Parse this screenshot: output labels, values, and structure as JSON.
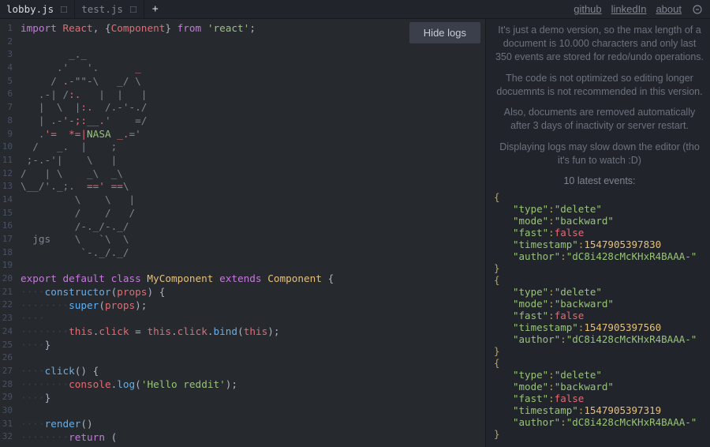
{
  "header": {
    "tabs": [
      {
        "label": "lobby.js",
        "active": true
      },
      {
        "label": "test.js",
        "active": false
      }
    ],
    "links": {
      "github": "github",
      "linkedin": "linkedIn",
      "about": "about"
    }
  },
  "hide_logs_button": "Hide logs",
  "code": {
    "lines": [
      [
        {
          "c": "tok-kw",
          "t": "import "
        },
        {
          "c": "tok-id",
          "t": "React"
        },
        {
          "c": "tok-op",
          "t": ", {"
        },
        {
          "c": "tok-id",
          "t": "Component"
        },
        {
          "c": "tok-op",
          "t": "} "
        },
        {
          "c": "tok-kw",
          "t": "from "
        },
        {
          "c": "tok-str",
          "t": "'react'"
        },
        {
          "c": "tok-op",
          "t": ";"
        }
      ],
      [],
      [
        {
          "c": "tok-cm-d",
          "t": "        _._"
        }
      ],
      [
        {
          "c": "tok-cm-d",
          "t": "      .'   '."
        },
        {
          "c": "tok-cm-r",
          "t": "      _"
        }
      ],
      [
        {
          "c": "tok-cm-d",
          "t": "     / "
        },
        {
          "c": "tok-cm-r",
          "t": "."
        },
        {
          "c": "tok-cm-d",
          "t": "-\"\"-\\   _/ \\"
        }
      ],
      [
        {
          "c": "tok-cm-d",
          "t": "   .-| /"
        },
        {
          "c": "tok-cm-r",
          "t": ":."
        },
        {
          "c": "tok-cm-d",
          "t": "   |  |   |"
        }
      ],
      [
        {
          "c": "tok-cm-d",
          "t": "   |  \\  |"
        },
        {
          "c": "tok-cm-r",
          "t": ":."
        },
        {
          "c": "tok-cm-d",
          "t": "  /.-'-./"
        }
      ],
      [
        {
          "c": "tok-cm-d",
          "t": "   | .-"
        },
        {
          "c": "tok-cm-r",
          "t": "'-;:__."
        },
        {
          "c": "tok-cm-d",
          "t": "'    =/"
        }
      ],
      [
        {
          "c": "tok-cm-d",
          "t": "   ."
        },
        {
          "c": "tok-cm-r",
          "t": "'=  *=|"
        },
        {
          "c": "tok-cm-g",
          "t": "NASA"
        },
        {
          "c": "tok-cm-r",
          "t": " _."
        },
        {
          "c": "tok-cm-d",
          "t": "='"
        }
      ],
      [
        {
          "c": "tok-cm-d",
          "t": "  /   _.  |    ;"
        }
      ],
      [
        {
          "c": "tok-cm-d",
          "t": " ;-.-'|    \\   |"
        }
      ],
      [
        {
          "c": "tok-cm-d",
          "t": "/   | \\    _\\  _\\"
        }
      ],
      [
        {
          "c": "tok-cm-d",
          "t": "\\__/'._;.  "
        },
        {
          "c": "tok-cm-r",
          "t": "==' =="
        },
        {
          "c": "tok-cm-d",
          "t": "\\"
        }
      ],
      [
        {
          "c": "tok-cm-d",
          "t": "         \\    \\   |"
        }
      ],
      [
        {
          "c": "tok-cm-d",
          "t": "         /    /   /"
        }
      ],
      [
        {
          "c": "tok-cm-d",
          "t": "         /-._/-._/"
        }
      ],
      [
        {
          "c": "tok-cm-d",
          "t": "  jgs    \\   `\\  \\"
        }
      ],
      [
        {
          "c": "tok-cm-d",
          "t": "          `-._/._/"
        }
      ],
      [],
      [
        {
          "c": "tok-kw",
          "t": "export default class "
        },
        {
          "c": "tok-cls",
          "t": "MyComponent"
        },
        {
          "c": "tok-kw",
          "t": " extends "
        },
        {
          "c": "tok-cls",
          "t": "Component"
        },
        {
          "c": "tok-op",
          "t": " {"
        }
      ],
      [
        {
          "c": "guide",
          "t": "····"
        },
        {
          "c": "tok-fn",
          "t": "constructor"
        },
        {
          "c": "tok-par",
          "t": "("
        },
        {
          "c": "tok-id",
          "t": "props"
        },
        {
          "c": "tok-par",
          "t": ") {"
        }
      ],
      [
        {
          "c": "guide",
          "t": "····"
        },
        {
          "c": "guide",
          "t": "····"
        },
        {
          "c": "tok-fn",
          "t": "super"
        },
        {
          "c": "tok-par",
          "t": "("
        },
        {
          "c": "tok-id",
          "t": "props"
        },
        {
          "c": "tok-par",
          "t": ");"
        }
      ],
      [
        {
          "c": "guide",
          "t": "····"
        }
      ],
      [
        {
          "c": "guide",
          "t": "····"
        },
        {
          "c": "guide",
          "t": "····"
        },
        {
          "c": "tok-id",
          "t": "this"
        },
        {
          "c": "tok-op",
          "t": "."
        },
        {
          "c": "tok-id",
          "t": "click"
        },
        {
          "c": "tok-op",
          "t": " = "
        },
        {
          "c": "tok-id",
          "t": "this"
        },
        {
          "c": "tok-op",
          "t": "."
        },
        {
          "c": "tok-id",
          "t": "click"
        },
        {
          "c": "tok-op",
          "t": "."
        },
        {
          "c": "tok-fn",
          "t": "bind"
        },
        {
          "c": "tok-par",
          "t": "("
        },
        {
          "c": "tok-id",
          "t": "this"
        },
        {
          "c": "tok-par",
          "t": ");"
        }
      ],
      [
        {
          "c": "guide",
          "t": "····"
        },
        {
          "c": "tok-par",
          "t": "}"
        }
      ],
      [],
      [
        {
          "c": "guide",
          "t": "····"
        },
        {
          "c": "tok-fn",
          "t": "click"
        },
        {
          "c": "tok-par",
          "t": "() {"
        }
      ],
      [
        {
          "c": "guide",
          "t": "····"
        },
        {
          "c": "guide",
          "t": "····"
        },
        {
          "c": "tok-id",
          "t": "console"
        },
        {
          "c": "tok-op",
          "t": "."
        },
        {
          "c": "tok-fn",
          "t": "log"
        },
        {
          "c": "tok-par",
          "t": "("
        },
        {
          "c": "tok-str",
          "t": "'Hello reddit'"
        },
        {
          "c": "tok-par",
          "t": ");"
        }
      ],
      [
        {
          "c": "guide",
          "t": "····"
        },
        {
          "c": "tok-par",
          "t": "}"
        }
      ],
      [],
      [
        {
          "c": "guide",
          "t": "····"
        },
        {
          "c": "tok-fn",
          "t": "render"
        },
        {
          "c": "tok-par",
          "t": "()"
        }
      ],
      [
        {
          "c": "guide",
          "t": "····"
        },
        {
          "c": "guide",
          "t": "····"
        },
        {
          "c": "tok-kw",
          "t": "return"
        },
        {
          "c": "tok-par",
          "t": " ("
        }
      ]
    ],
    "line_start": 1,
    "line_count": 32
  },
  "side": {
    "info": [
      "It's just a demo version, so the max length of a document is 10.000 characters and only last 350 events are stored for redo/undo operations.",
      "The code is not optimized so editing longer docuemnts is not recommended in this version.",
      "Also, documents are removed automatically after 3 days of inactivity or server restart.",
      "Displaying logs may slow down the editor (tho it's fun to watch :D)"
    ],
    "events_title": "10 latest events:",
    "events": [
      {
        "type": "delete",
        "mode": "backward",
        "fast": false,
        "timestamp": 1547905397830,
        "author": "dC8i428cMcKHxR4BAAA-"
      },
      {
        "type": "delete",
        "mode": "backward",
        "fast": false,
        "timestamp": 1547905397560,
        "author": "dC8i428cMcKHxR4BAAA-"
      },
      {
        "type": "delete",
        "mode": "backward",
        "fast": false,
        "timestamp": 1547905397319,
        "author": "dC8i428cMcKHxR4BAAA-"
      }
    ]
  }
}
